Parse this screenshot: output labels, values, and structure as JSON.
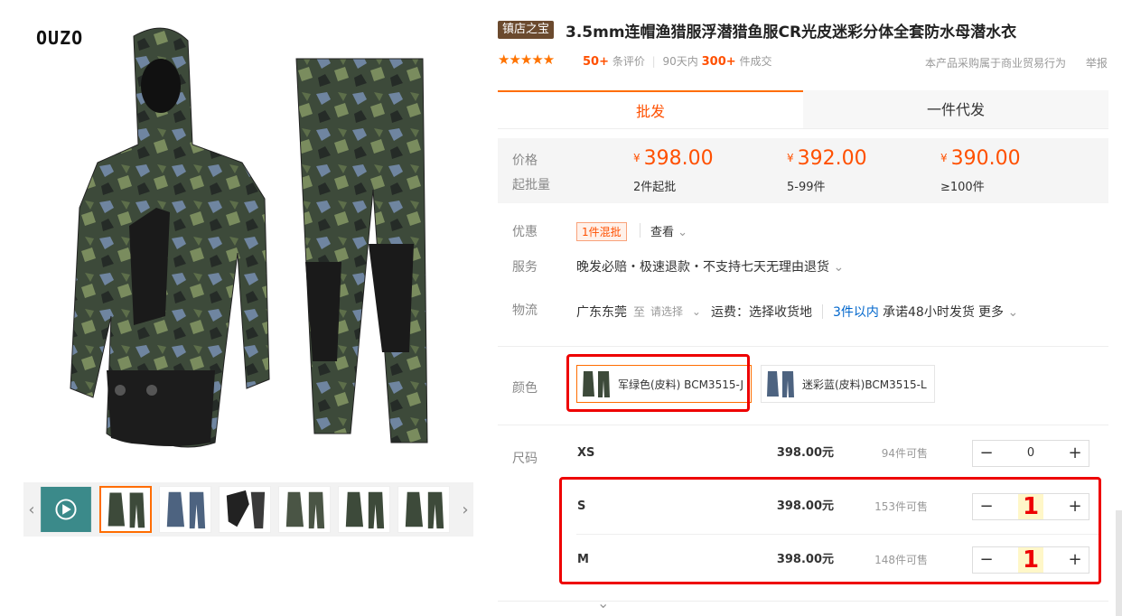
{
  "gallery": {
    "brand": "OUZO",
    "prev_label": "‹",
    "next_label": "›",
    "thumbnails": [
      "video",
      "photo-1",
      "photo-2",
      "photo-3",
      "photo-4",
      "photo-5",
      "photo-6"
    ]
  },
  "product": {
    "badge": "镇店之宝",
    "title": "3.5mm连帽渔猎服浮潜猎鱼服CR光皮迷彩分体全套防水母潜水衣",
    "stars": "★★★★★",
    "reviews_count": "50+",
    "reviews_label": "条评价",
    "sales_prefix": "90天内",
    "sales_count": "300+",
    "sales_suffix": "件成交",
    "notice": "本产品采购属于商业贸易行为",
    "report": "举报"
  },
  "tabs": {
    "wholesale": "批发",
    "dropship": "一件代发"
  },
  "pricing": {
    "price_label": "价格",
    "moq_label": "起批量",
    "currency": "¥",
    "tiers": [
      {
        "price": "398.00",
        "qty": "2件起批"
      },
      {
        "price": "392.00",
        "qty": "5-99件"
      },
      {
        "price": "390.00",
        "qty": "≥100件"
      }
    ]
  },
  "promo": {
    "label": "优惠",
    "tag": "1件混批",
    "view": "查看"
  },
  "service": {
    "label": "服务",
    "text": "晚发必赔・极速退款・不支持七天无理由退货"
  },
  "logistics": {
    "label": "物流",
    "from": "广东东莞",
    "to_prefix": "至",
    "to_placeholder": "请选择",
    "freight": "运费：选择收货地",
    "ship_hl": "3件以内",
    "ship_text": "承诺48小时发货",
    "more": "更多"
  },
  "color": {
    "label": "颜色",
    "options": [
      {
        "name": "军绿色(皮料) BCM3515-J",
        "selected": true
      },
      {
        "name": "迷彩蓝(皮料)BCM3515-L",
        "selected": false
      }
    ]
  },
  "size": {
    "label": "尺码",
    "rows": [
      {
        "name": "XS",
        "price": "398.00元",
        "stock": "94件可售",
        "qty": "0"
      },
      {
        "name": "S",
        "price": "398.00元",
        "stock": "153件可售",
        "qty": "1"
      },
      {
        "name": "M",
        "price": "398.00元",
        "stock": "148件可售",
        "qty": "1"
      }
    ],
    "minus": "−",
    "plus": "+"
  },
  "colors": {
    "accent": "#ff5000",
    "tab_accent": "#ff6d00",
    "highlight": "#e00000",
    "badge": "#6b4a2e"
  }
}
